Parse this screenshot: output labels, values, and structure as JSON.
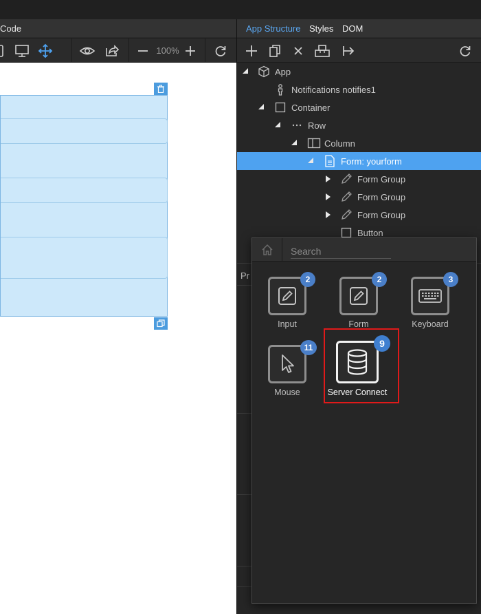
{
  "left_panel": {
    "tab_label": "Code",
    "zoom_level": "100%"
  },
  "right_panel": {
    "tabs": [
      {
        "label": "App Structure",
        "active": true
      },
      {
        "label": "Styles",
        "active": false
      },
      {
        "label": "DOM",
        "active": false
      }
    ],
    "tree": [
      {
        "label": "App",
        "icon": "cube-icon",
        "expanded": true
      },
      {
        "label": "Notifications notifies1",
        "icon": "person-icon"
      },
      {
        "label": "Container",
        "icon": "square-icon",
        "expanded": true
      },
      {
        "label": "Row",
        "icon": "dots-icon",
        "expanded": true
      },
      {
        "label": "Column",
        "icon": "columns-icon",
        "expanded": true
      },
      {
        "label": "Form: yourform",
        "icon": "document-icon",
        "expanded": true,
        "selected": true
      },
      {
        "label": "Form Group",
        "icon": "pencil-icon",
        "expanded": false
      },
      {
        "label": "Form Group",
        "icon": "pencil-icon",
        "expanded": false
      },
      {
        "label": "Form Group",
        "icon": "pencil-icon",
        "expanded": false
      },
      {
        "label": "Button",
        "icon": "square-icon"
      }
    ],
    "under_label": "Pr"
  },
  "picker": {
    "search_placeholder": "Search",
    "tiles": [
      {
        "label": "Input",
        "count": "2",
        "icon": "pencil-square-icon"
      },
      {
        "label": "Form",
        "count": "2",
        "icon": "pencil-square-icon"
      },
      {
        "label": "Keyboard",
        "count": "3",
        "icon": "keyboard-icon"
      },
      {
        "label": "Mouse",
        "count": "11",
        "icon": "cursor-icon"
      },
      {
        "label": "Server Connect",
        "count": "9",
        "icon": "database-icon",
        "highlighted": true
      }
    ]
  },
  "colors": {
    "accent": "#4ea2f0",
    "badge": "#4a7fc8",
    "highlight": "#e01a1a"
  }
}
